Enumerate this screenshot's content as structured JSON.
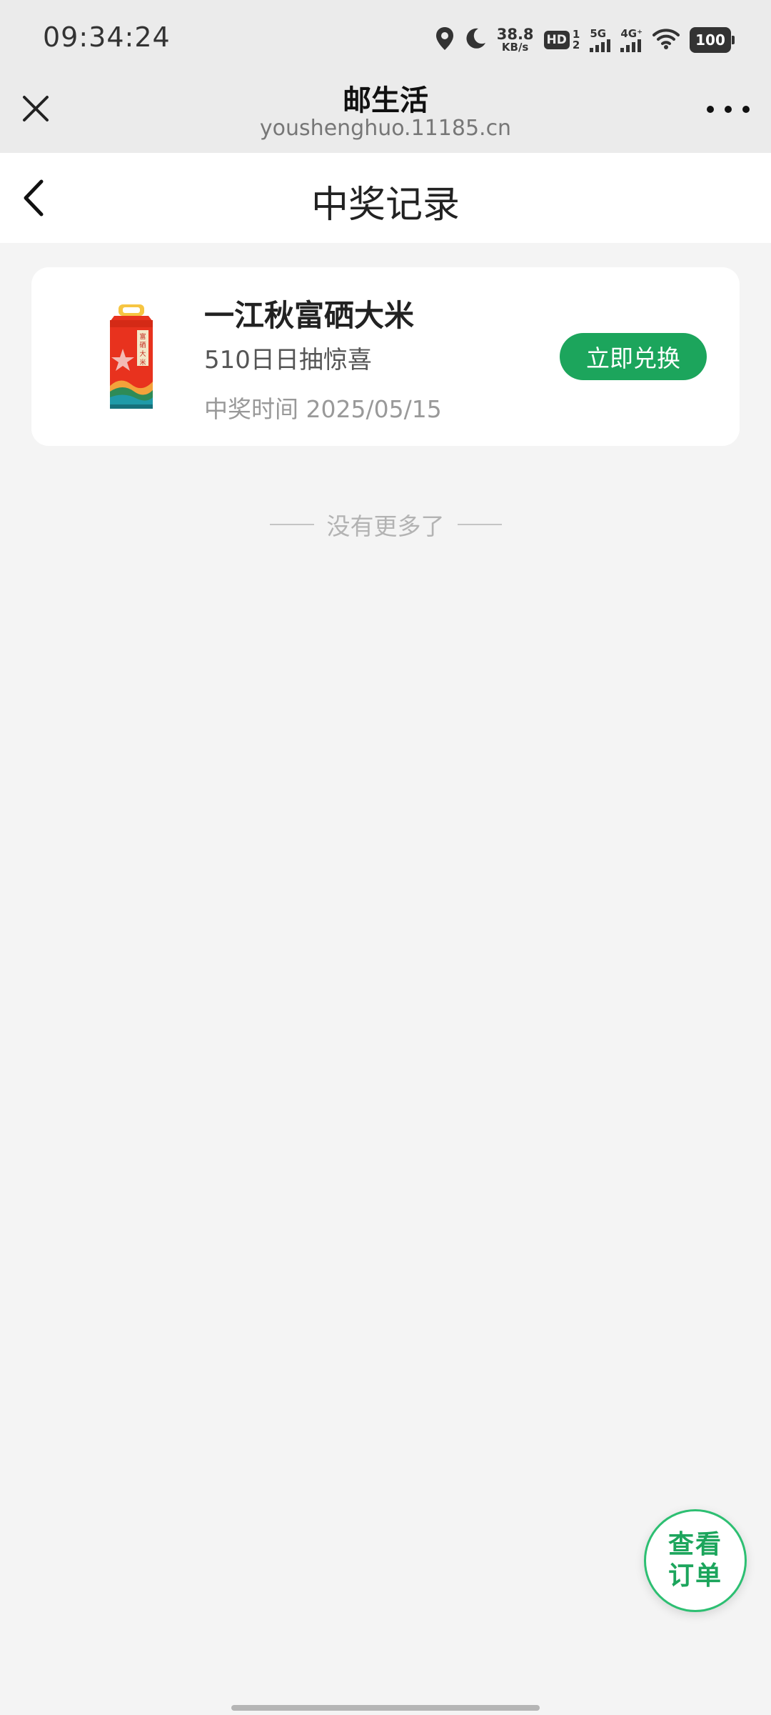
{
  "status_bar": {
    "time": "09:34:24",
    "net_speed_value": "38.8",
    "net_speed_unit": "KB/s",
    "hd_label": "HD",
    "hd_sim_top": "1",
    "hd_sim_bottom": "2",
    "signal1_label": "5G",
    "signal2_label": "4G⁺",
    "battery": "100"
  },
  "browser": {
    "title": "邮生活",
    "url": "youshenghuo.11185.cn"
  },
  "page": {
    "title": "中奖记录"
  },
  "prize_card": {
    "name": "一江秋富硒大米",
    "activity": "510日日抽惊喜",
    "time_label": "中奖时间 2025/05/15",
    "redeem_button": "立即兑换",
    "package_text": "富硒大米"
  },
  "list_end": {
    "text": "没有更多了"
  },
  "fab": {
    "line1": "查看",
    "line2": "订单"
  },
  "colors": {
    "accent": "#1ca55c",
    "background": "#f4f4f4",
    "bar_background": "#ebebeb"
  }
}
